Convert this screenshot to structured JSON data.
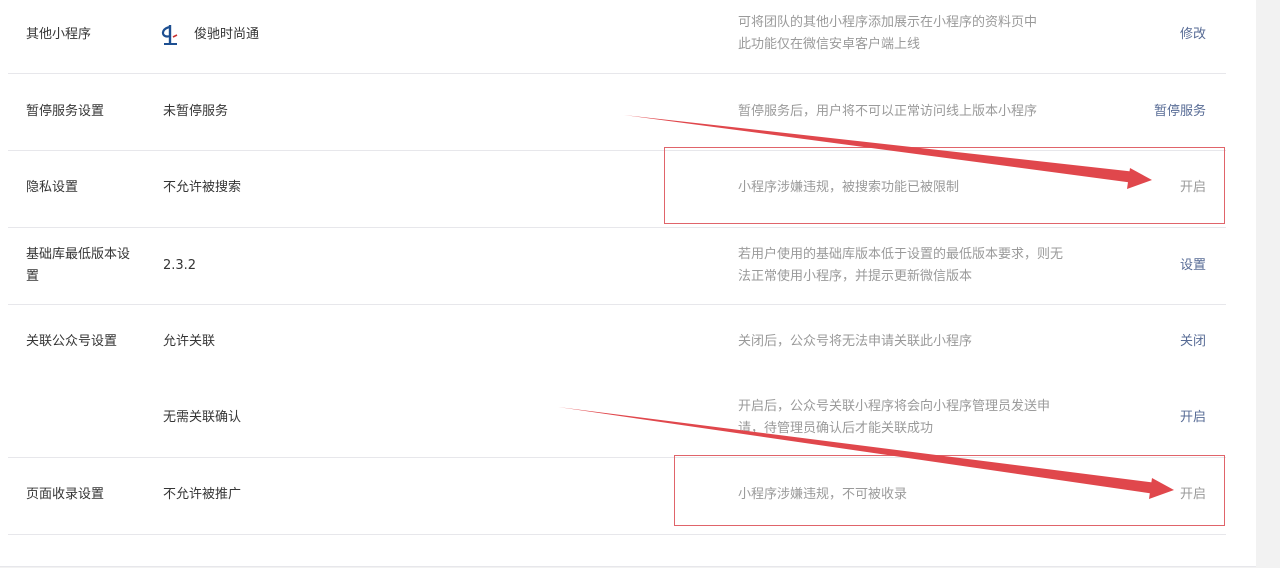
{
  "rows": {
    "other_programs": {
      "label": "其他小程序",
      "value": "俊驰时尚通",
      "desc_line1": "可将团队的其他小程序添加展示在小程序的资料页中",
      "desc_line2": "此功能仅在微信安卓客户端上线",
      "action": "修改"
    },
    "pause_service": {
      "label": "暂停服务设置",
      "value": "未暂停服务",
      "desc": "暂停服务后，用户将不可以正常访问线上版本小程序",
      "action": "暂停服务"
    },
    "privacy": {
      "label": "隐私设置",
      "value": "不允许被搜索",
      "desc": "小程序涉嫌违规，被搜索功能已被限制",
      "action": "开启"
    },
    "base_lib": {
      "label_line1": "基础库最低版本设",
      "label_line2": "置",
      "value": "2.3.2",
      "desc_line1": "若用户使用的基础库版本低于设置的最低版本要求，则无",
      "desc_line2": "法正常使用小程序，并提示更新微信版本",
      "action": "设置"
    },
    "official_account": {
      "label": "关联公众号设置",
      "value": "允许关联",
      "desc": "关闭后，公众号将无法申请关联此小程序",
      "action": "关闭"
    },
    "association_confirm": {
      "value": "无需关联确认",
      "desc_line1": "开启后，公众号关联小程序将会向小程序管理员发送申",
      "desc_line2": "请，待管理员确认后才能关联成功",
      "action": "开启"
    },
    "page_indexing": {
      "label": "页面收录设置",
      "value": "不允许被推广",
      "desc": "小程序涉嫌违规，不可被收录",
      "action": "开启"
    }
  },
  "colors": {
    "link": "#576b95",
    "muted": "#9a9a9a",
    "annotation_red": "#e0474c"
  }
}
